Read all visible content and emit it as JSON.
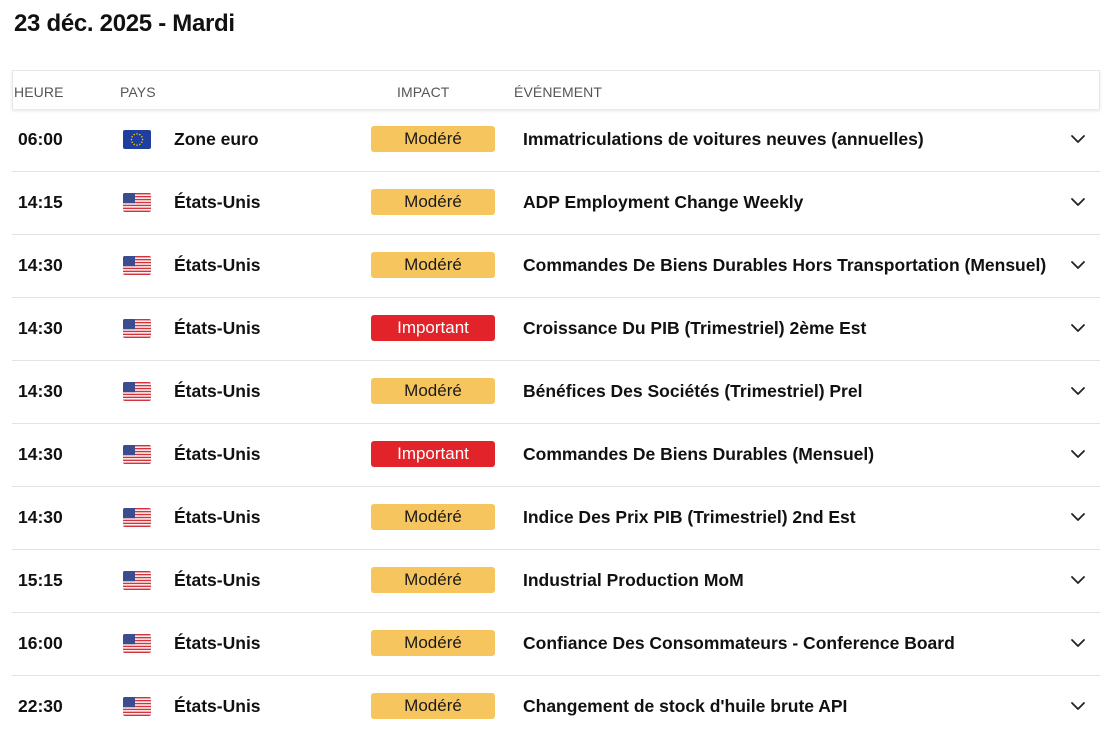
{
  "header": {
    "date_title": "23 déc. 2025 - Mardi"
  },
  "columns": {
    "heure": "HEURE",
    "pays": "PAYS",
    "impact": "IMPACT",
    "evenement": "ÉVÉNEMENT"
  },
  "colors": {
    "moderate": "#f6c55e",
    "important": "#e2232a"
  },
  "rows": [
    {
      "time": "06:00",
      "flag": "eu-flag",
      "country": "Zone euro",
      "impact": "Modéré",
      "level": "moderate",
      "event": "Immatriculations de voitures neuves (annuelles)"
    },
    {
      "time": "14:15",
      "flag": "us-flag",
      "country": "États-Unis",
      "impact": "Modéré",
      "level": "moderate",
      "event": "ADP Employment Change Weekly"
    },
    {
      "time": "14:30",
      "flag": "us-flag",
      "country": "États-Unis",
      "impact": "Modéré",
      "level": "moderate",
      "event": "Commandes De Biens Durables Hors Transportation (Mensuel)"
    },
    {
      "time": "14:30",
      "flag": "us-flag",
      "country": "États-Unis",
      "impact": "Important",
      "level": "important",
      "event": "Croissance Du PIB (Trimestriel) 2ème Est"
    },
    {
      "time": "14:30",
      "flag": "us-flag",
      "country": "États-Unis",
      "impact": "Modéré",
      "level": "moderate",
      "event": "Bénéfices Des Sociétés (Trimestriel) Prel"
    },
    {
      "time": "14:30",
      "flag": "us-flag",
      "country": "États-Unis",
      "impact": "Important",
      "level": "important",
      "event": "Commandes De Biens Durables (Mensuel)"
    },
    {
      "time": "14:30",
      "flag": "us-flag",
      "country": "États-Unis",
      "impact": "Modéré",
      "level": "moderate",
      "event": "Indice Des Prix PIB (Trimestriel) 2nd Est"
    },
    {
      "time": "15:15",
      "flag": "us-flag",
      "country": "États-Unis",
      "impact": "Modéré",
      "level": "moderate",
      "event": "Industrial Production MoM"
    },
    {
      "time": "16:00",
      "flag": "us-flag",
      "country": "États-Unis",
      "impact": "Modéré",
      "level": "moderate",
      "event": "Confiance Des Consommateurs - Conference Board"
    },
    {
      "time": "22:30",
      "flag": "us-flag",
      "country": "États-Unis",
      "impact": "Modéré",
      "level": "moderate",
      "event": "Changement de stock d'huile brute API"
    }
  ]
}
